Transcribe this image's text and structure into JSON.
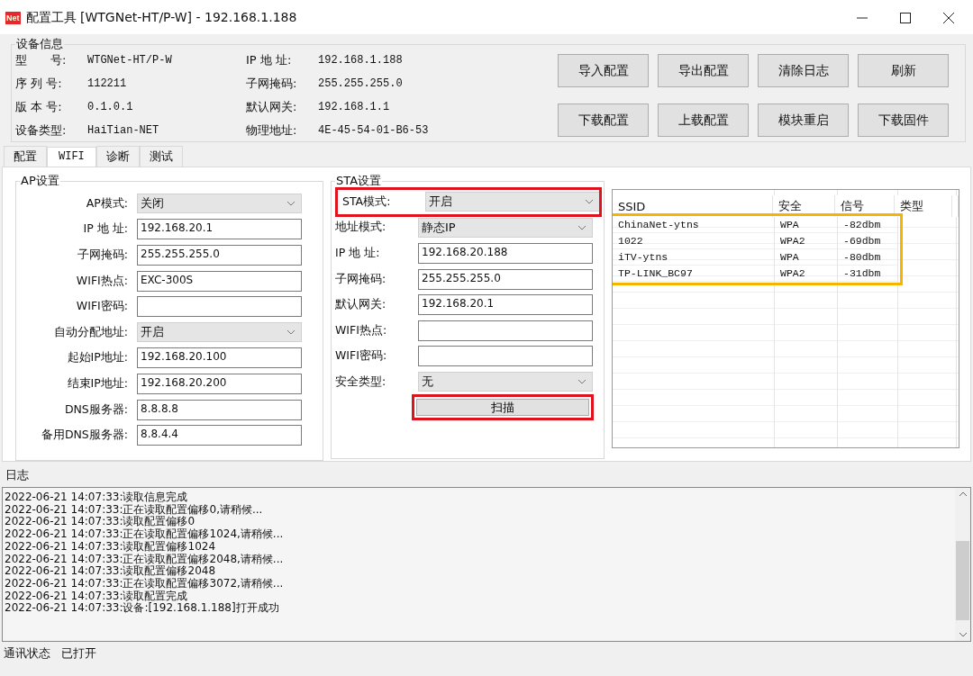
{
  "window": {
    "title": "配置工具 [WTGNet-HT/P-W] - 192.168.1.188",
    "app_icon_text": "Net"
  },
  "device_info": {
    "title": "设备信息",
    "left": [
      {
        "label": "型　　号:",
        "value": "WTGNet-HT/P-W"
      },
      {
        "label": "序 列 号:",
        "value": "112211"
      },
      {
        "label": "版 本 号:",
        "value": "0.1.0.1"
      },
      {
        "label": "设备类型:",
        "value": "HaiTian-NET"
      }
    ],
    "right": [
      {
        "label": "IP 地 址:",
        "value": "192.168.1.188"
      },
      {
        "label": "子网掩码:",
        "value": "255.255.255.0"
      },
      {
        "label": "默认网关:",
        "value": "192.168.1.1"
      },
      {
        "label": "物理地址:",
        "value": "4E-45-54-01-B6-53"
      }
    ]
  },
  "buttons": [
    [
      "导入配置",
      "导出配置",
      "清除日志",
      "刷新"
    ],
    [
      "下载配置",
      "上载配置",
      "模块重启",
      "下载固件"
    ]
  ],
  "tabs": [
    {
      "label": "配置",
      "selected": false
    },
    {
      "label": "WIFI",
      "selected": true
    },
    {
      "label": "诊断",
      "selected": false
    },
    {
      "label": "测试",
      "selected": false
    }
  ],
  "ap_settings": {
    "title": "AP设置",
    "fields": [
      {
        "kind": "select",
        "label": "AP模式:",
        "value": "关闭"
      },
      {
        "kind": "text",
        "label": "IP 地 址:",
        "value": "192.168.20.1"
      },
      {
        "kind": "text",
        "label": "子网掩码:",
        "value": "255.255.255.0"
      },
      {
        "kind": "text",
        "label": "WIFI热点:",
        "value": "EXC-300S"
      },
      {
        "kind": "text",
        "label": "WIFI密码:"
      },
      {
        "kind": "select",
        "label": "自动分配地址:",
        "value": "开启"
      },
      {
        "kind": "text",
        "label": "起始IP地址:",
        "value": "192.168.20.100"
      },
      {
        "kind": "text",
        "label": "结束IP地址:",
        "value": "192.168.20.200"
      },
      {
        "kind": "text",
        "label": "DNS服务器:",
        "value": "8.8.8.8"
      },
      {
        "kind": "text",
        "label": "备用DNS服务器:",
        "value": "8.8.4.4"
      }
    ]
  },
  "sta_settings": {
    "title": "STA设置",
    "fields": [
      {
        "kind": "select",
        "label": "STA模式:",
        "value": "开启",
        "highlighted": true
      },
      {
        "kind": "select",
        "label": "地址模式:",
        "value": "静态IP",
        "highlighted": false
      },
      {
        "kind": "text",
        "label": "IP 地 址:",
        "value": "192.168.20.188",
        "highlighted": false
      },
      {
        "kind": "text",
        "label": "子网掩码:",
        "value": "255.255.255.0",
        "highlighted": false
      },
      {
        "kind": "text",
        "label": "默认网关:",
        "value": "192.168.20.1",
        "highlighted": false
      },
      {
        "kind": "text",
        "label": "WIFI热点:",
        "highlighted": false
      },
      {
        "kind": "text",
        "label": "WIFI密码:",
        "highlighted": false
      },
      {
        "kind": "select",
        "label": "安全类型:",
        "value": "无",
        "highlighted": false
      }
    ],
    "scan_button": {
      "label": "扫描",
      "highlighted": true
    }
  },
  "wifi_table": {
    "columns": [
      "SSID",
      "安全",
      "信号",
      "类型"
    ],
    "rows_highlighted": true,
    "rows": [
      [
        "ChinaNet-ytns",
        "WPA",
        "-82dbm"
      ],
      [
        "1022",
        "WPA2",
        "-69dbm"
      ],
      [
        "iTV-ytns",
        "WPA",
        "-80dbm"
      ],
      [
        "TP-LINK_BC97",
        "WPA2",
        "-31dbm"
      ]
    ]
  },
  "log": {
    "title": "日志",
    "lines": [
      "2022-06-21 14:07:33:读取信息完成",
      "2022-06-21 14:07:33:正在读取配置偏移0,请稍候...",
      "2022-06-21 14:07:33:读取配置偏移0",
      "2022-06-21 14:07:33:正在读取配置偏移1024,请稍候...",
      "2022-06-21 14:07:33:读取配置偏移1024",
      "2022-06-21 14:07:33:正在读取配置偏移2048,请稍候...",
      "2022-06-21 14:07:33:读取配置偏移2048",
      "2022-06-21 14:07:33:正在读取配置偏移3072,请稍候...",
      "2022-06-21 14:07:33:读取配置完成",
      "2022-06-21 14:07:33:设备:[192.168.1.188]打开成功"
    ]
  },
  "status_bar": {
    "label": "通讯状态",
    "value": "已打开"
  }
}
